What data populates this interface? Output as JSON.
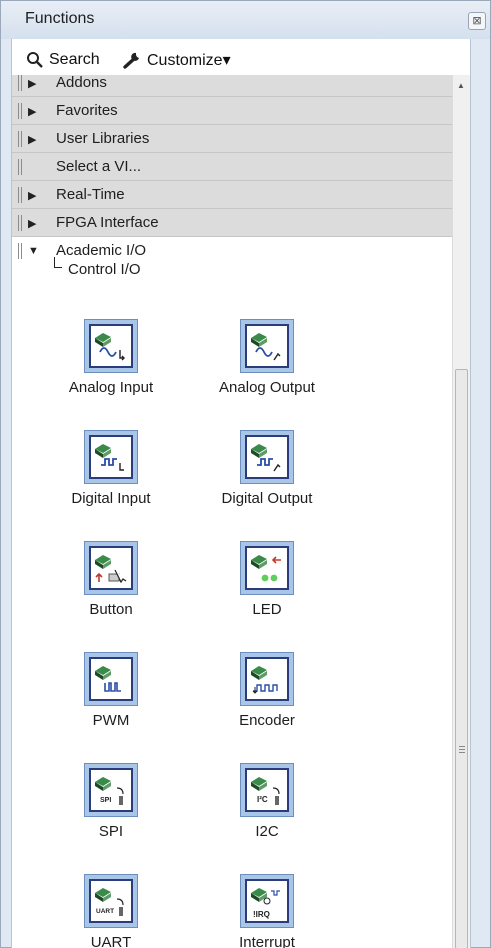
{
  "window": {
    "title": "Functions",
    "close_glyph": "⊠"
  },
  "toolbar": {
    "search_label": "Search",
    "customize_label": "Customize▾"
  },
  "categories": [
    {
      "label": "Addons",
      "arrow": "▶",
      "expanded": false
    },
    {
      "label": "Favorites",
      "arrow": "▶",
      "expanded": false
    },
    {
      "label": "User Libraries",
      "arrow": "▶",
      "expanded": false
    },
    {
      "label": "Select a VI...",
      "arrow": "",
      "expanded": false
    },
    {
      "label": "Real-Time",
      "arrow": "▶",
      "expanded": false
    },
    {
      "label": "FPGA Interface",
      "arrow": "▶",
      "expanded": false
    },
    {
      "label": "Academic I/O",
      "arrow": "▼",
      "expanded": true
    }
  ],
  "subcategory": {
    "label": "Control I/O"
  },
  "functions": [
    {
      "label": "Analog Input",
      "icon": "analog-input-icon"
    },
    {
      "label": "Analog Output",
      "icon": "analog-output-icon"
    },
    {
      "label": "Digital Input",
      "icon": "digital-input-icon"
    },
    {
      "label": "Digital Output",
      "icon": "digital-output-icon"
    },
    {
      "label": "Button",
      "icon": "button-icon"
    },
    {
      "label": "LED",
      "icon": "led-icon"
    },
    {
      "label": "PWM",
      "icon": "pwm-icon"
    },
    {
      "label": "Encoder",
      "icon": "encoder-icon"
    },
    {
      "label": "SPI",
      "icon": "spi-icon",
      "icon_text": "SPI"
    },
    {
      "label": "I2C",
      "icon": "i2c-icon",
      "icon_text": "I²C"
    },
    {
      "label": "UART",
      "icon": "uart-icon",
      "icon_text": "UART"
    },
    {
      "label": "Interrupt",
      "icon": "interrupt-icon",
      "icon_text": "!IRQ"
    }
  ],
  "colors": {
    "category_bg": "#dcdcdc",
    "icon_frame": "#a9c5e8",
    "icon_border": "#2b3c7a",
    "titlebar": "#dfe8f3"
  }
}
